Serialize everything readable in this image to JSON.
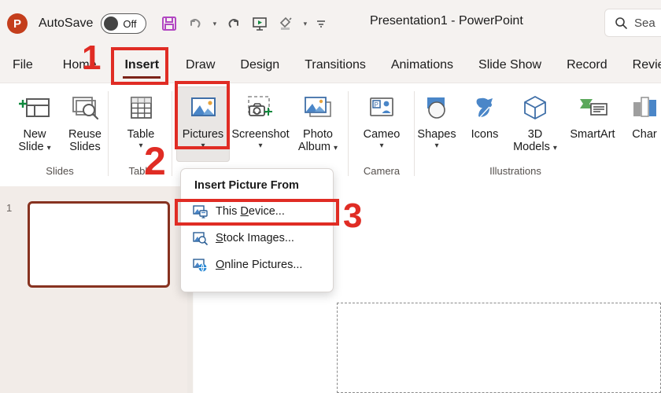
{
  "app": {
    "logo_letter": "P",
    "autosave_label": "AutoSave",
    "autosave_state": "Off",
    "document_title": "Presentation1  -  PowerPoint",
    "search_text": "Sea",
    "quick_access": [
      {
        "name": "save-icon",
        "label": "Save"
      },
      {
        "name": "undo-icon",
        "label": "Undo"
      },
      {
        "name": "redo-icon",
        "label": "Redo"
      },
      {
        "name": "start-presentation-icon",
        "label": "Start From Beginning"
      },
      {
        "name": "format-painter-icon",
        "label": "Format Painter"
      },
      {
        "name": "customize-quick-access-toolbar-icon",
        "label": "Customize Quick Access Toolbar"
      }
    ]
  },
  "tabs": [
    {
      "label": "File",
      "active": false
    },
    {
      "label": "Home",
      "active": false
    },
    {
      "label": "Insert",
      "active": true
    },
    {
      "label": "Draw",
      "active": false
    },
    {
      "label": "Design",
      "active": false
    },
    {
      "label": "Transitions",
      "active": false
    },
    {
      "label": "Animations",
      "active": false
    },
    {
      "label": "Slide Show",
      "active": false
    },
    {
      "label": "Record",
      "active": false
    },
    {
      "label": "Review",
      "active": false
    }
  ],
  "ribbon": {
    "groups": [
      {
        "name": "slides",
        "label": "Slides",
        "buttons": [
          {
            "name": "new-slide-button",
            "line1": "New",
            "line2": "Slide",
            "caret": "⌄",
            "icon": "new-slide-icon"
          },
          {
            "name": "reuse-slides-button",
            "line1": "Reuse",
            "line2": "Slides",
            "caret": "",
            "icon": "reuse-slides-icon"
          }
        ]
      },
      {
        "name": "table",
        "label": "Table",
        "buttons": [
          {
            "name": "table-button",
            "line1": "Table",
            "line2": "",
            "caret": "⌄",
            "icon": "table-icon"
          }
        ]
      },
      {
        "name": "images",
        "label": "",
        "buttons": [
          {
            "name": "pictures-button",
            "line1": "Pictures",
            "line2": "",
            "caret": "⌄",
            "icon": "pictures-icon"
          },
          {
            "name": "screenshot-button",
            "line1": "Screenshot",
            "line2": "",
            "caret": "⌄",
            "icon": "screenshot-icon"
          },
          {
            "name": "photo-album-button",
            "line1": "Photo",
            "line2": "Album",
            "caret": "⌄",
            "icon": "photo-album-icon"
          }
        ]
      },
      {
        "name": "camera",
        "label": "Camera",
        "buttons": [
          {
            "name": "cameo-button",
            "line1": "Cameo",
            "line2": "",
            "caret": "⌄",
            "icon": "cameo-icon"
          }
        ]
      },
      {
        "name": "illustrations",
        "label": "Illustrations",
        "buttons": [
          {
            "name": "shapes-button",
            "line1": "Shapes",
            "line2": "",
            "caret": "⌄",
            "icon": "shapes-icon"
          },
          {
            "name": "icons-button",
            "line1": "Icons",
            "line2": "",
            "caret": "",
            "icon": "icons-icon"
          },
          {
            "name": "3d-models-button",
            "line1": "3D",
            "line2": "Models",
            "caret": "⌄",
            "icon": "3d-models-icon"
          },
          {
            "name": "smartart-button",
            "line1": "SmartArt",
            "line2": "",
            "caret": "",
            "icon": "smartart-icon"
          },
          {
            "name": "chart-button",
            "line1": "Char",
            "line2": "",
            "caret": "",
            "icon": "chart-icon"
          }
        ]
      }
    ]
  },
  "menu": {
    "title": "Insert Picture From",
    "items": [
      {
        "name": "menu-item-this-device",
        "pre": "This ",
        "key": "D",
        "post": "evice...",
        "icon": "this-device-icon",
        "highlighted": true
      },
      {
        "name": "menu-item-stock-images",
        "pre": "",
        "key": "S",
        "post": "tock Images...",
        "icon": "stock-images-icon",
        "highlighted": false
      },
      {
        "name": "menu-item-online-pictures",
        "pre": "",
        "key": "O",
        "post": "nline Pictures...",
        "icon": "online-pictures-icon",
        "highlighted": false
      }
    ]
  },
  "slide_panel": {
    "slide_number": "1"
  },
  "annotations": {
    "step1": "1",
    "step2": "2",
    "step3": "3",
    "color": "#e02c24"
  }
}
